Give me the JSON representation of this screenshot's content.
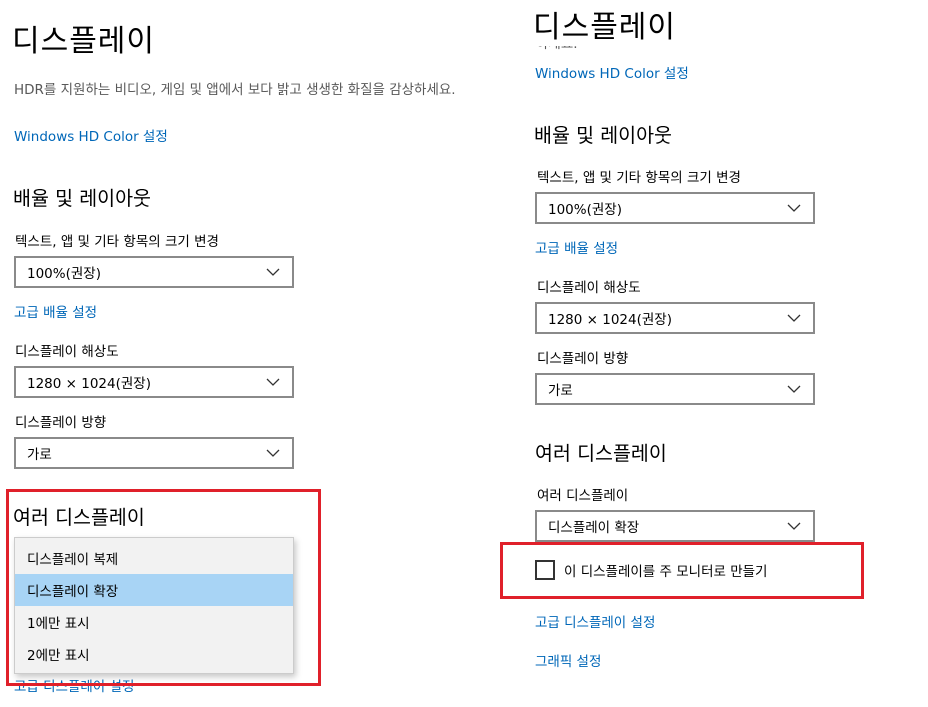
{
  "left": {
    "page_title": "디스플레이",
    "hdr_description": "HDR를 지원하는 비디오, 게임 및 앱에서 보다 밝고 생생한 화질을 감상하세요.",
    "hdr_link": "Windows HD Color 설정",
    "scale_section": "배율 및 레이아웃",
    "text_size_label": "텍스트, 앱 및 기타 항목의 크기 변경",
    "text_size_value": "100%(권장)",
    "advanced_scale_link": "고급 배율 설정",
    "resolution_label": "디스플레이 해상도",
    "resolution_value": "1280 × 1024(권장)",
    "orientation_label": "디스플레이 방향",
    "orientation_value": "가로",
    "multi_section": "여러 디스플레이",
    "menu_options": [
      "디스플레이 복제",
      "디스플레이 확장",
      "1에만 표시",
      "2에만 표시"
    ],
    "menu_selected": "디스플레이 확장",
    "advanced_display_link": "고급 디스플레이 설정"
  },
  "right": {
    "page_title": "디스플레이",
    "hdr_partial_text": "하세요.",
    "hdr_link": "Windows HD Color 설정",
    "scale_section": "배율 및 레이아웃",
    "text_size_label": "텍스트, 앱 및 기타 항목의 크기 변경",
    "text_size_value": "100%(권장)",
    "advanced_scale_link": "고급 배율 설정",
    "resolution_label": "디스플레이 해상도",
    "resolution_value": "1280 × 1024(권장)",
    "orientation_label": "디스플레이 방향",
    "orientation_value": "가로",
    "multi_section": "여러 디스플레이",
    "multi_label": "여러 디스플레이",
    "multi_value": "디스플레이 확장",
    "main_monitor_checkbox": "이 디스플레이를 주 모니터로 만들기",
    "advanced_display_link": "고급 디스플레이 설정",
    "graphics_link": "그래픽 설정"
  },
  "colors": {
    "accent_link": "#0067b8",
    "highlight_box": "#e0202a",
    "menu_selected": "#a8d4f5"
  },
  "icons": {
    "dropdown": "chevron-down-icon"
  }
}
